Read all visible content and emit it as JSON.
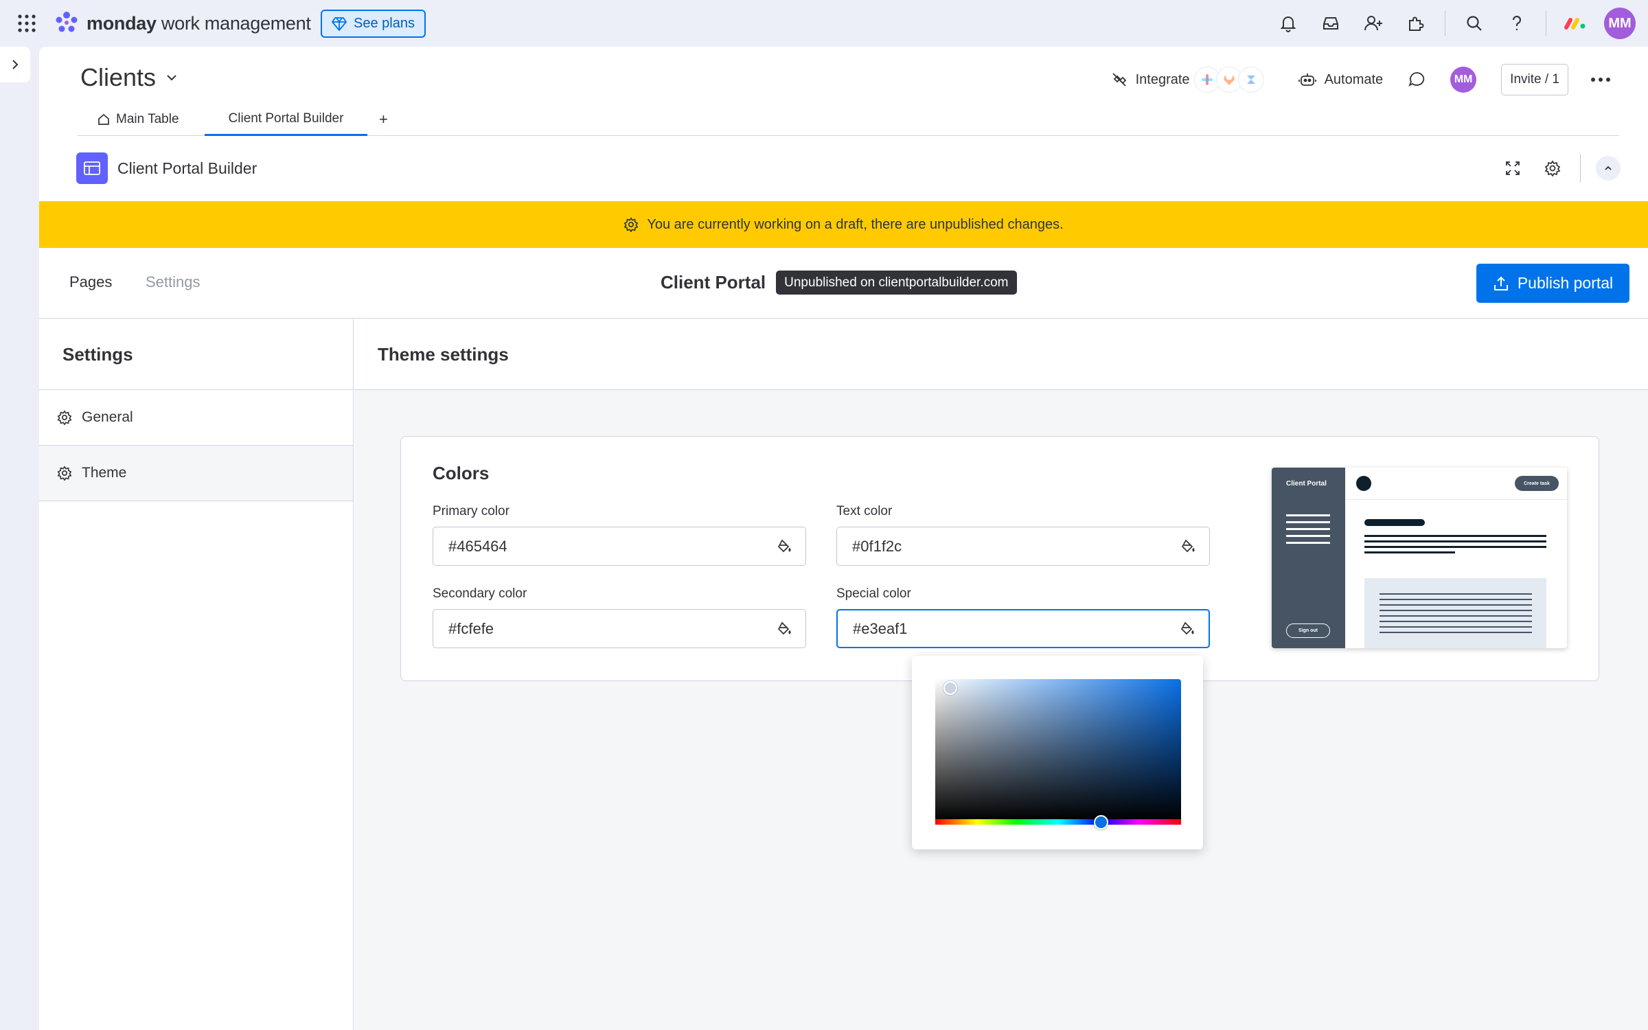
{
  "topbar": {
    "brand_bold": "monday",
    "brand_rest": " work management",
    "see_plans": "See plans",
    "user_initials": "MM"
  },
  "board": {
    "title": "Clients",
    "tabs": [
      {
        "label": "Main Table"
      },
      {
        "label": "Client Portal Builder"
      }
    ],
    "add_tab": "+",
    "integrate": "Integrate",
    "automate": "Automate",
    "member_initials": "MM",
    "invite": "Invite / 1"
  },
  "widget": {
    "name": "Client Portal Builder"
  },
  "banner": {
    "text": "You are currently working on a draft, there are unpublished changes."
  },
  "portal": {
    "tabs": {
      "pages": "Pages",
      "settings": "Settings"
    },
    "title": "Client Portal",
    "status": "Unpublished on clientportalbuilder.com",
    "publish": "Publish portal"
  },
  "sidebar": {
    "heading": "Settings",
    "items": [
      {
        "label": "General"
      },
      {
        "label": "Theme"
      }
    ]
  },
  "theme": {
    "heading": "Theme settings",
    "colors_title": "Colors",
    "fields": {
      "primary": {
        "label": "Primary color",
        "value": "#465464"
      },
      "text": {
        "label": "Text color",
        "value": "#0f1f2c"
      },
      "secondary": {
        "label": "Secondary color",
        "value": "#fcfefe"
      },
      "special": {
        "label": "Special color",
        "value": "#e3eaf1"
      }
    }
  },
  "preview": {
    "title": "Client Portal",
    "create_task": "Create task",
    "sign_out": "Sign out"
  },
  "colors": {
    "accent": "#0073ea",
    "banner": "#ffcb00",
    "avatar": "#a25ddc",
    "widget_icon": "#6161ff"
  }
}
